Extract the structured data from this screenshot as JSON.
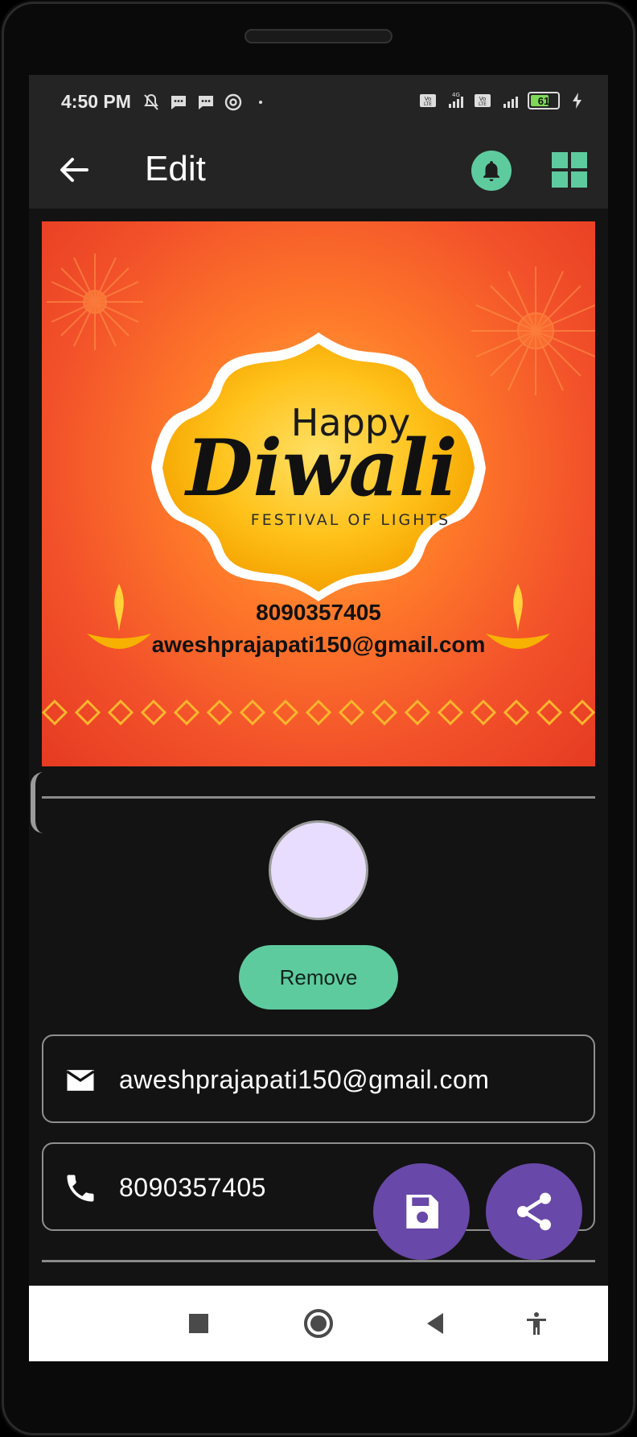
{
  "status_bar": {
    "time": "4:50 PM",
    "battery_level": "61",
    "icons": [
      "mute-bell-icon",
      "message-icon",
      "message-icon",
      "at-sign-icon",
      "dot-icon",
      "volte-icon",
      "signal-4g-icon",
      "volte-icon",
      "signal-icon",
      "battery-icon",
      "charging-icon"
    ]
  },
  "app_bar": {
    "title": "Edit",
    "back_icon": "arrow-left-icon",
    "notification_icon": "bell-icon",
    "grid_icon": "grid-icon"
  },
  "poster": {
    "greeting_small": "Happy",
    "greeting_large": "Diwali",
    "tagline": "FESTIVAL OF LIGHTS",
    "phone": "8090357405",
    "email": "aweshprajapati150@gmail.com"
  },
  "remove_button": {
    "label": "Remove"
  },
  "fields": {
    "email": {
      "value": "aweshprajapati150@gmail.com",
      "icon": "mail-icon"
    },
    "phone": {
      "value": "8090357405",
      "icon": "phone-icon"
    }
  },
  "fabs": {
    "save_icon": "save-icon",
    "share_icon": "share-icon"
  },
  "nav_bar": {
    "items": [
      "recents-square-icon",
      "home-circle-icon",
      "back-triangle-icon",
      "accessibility-icon"
    ]
  },
  "colors": {
    "accent_green": "#5ecb9f",
    "fab_purple": "#6848a8",
    "avatar_lavender": "#e8ddff",
    "background": "#131313"
  }
}
